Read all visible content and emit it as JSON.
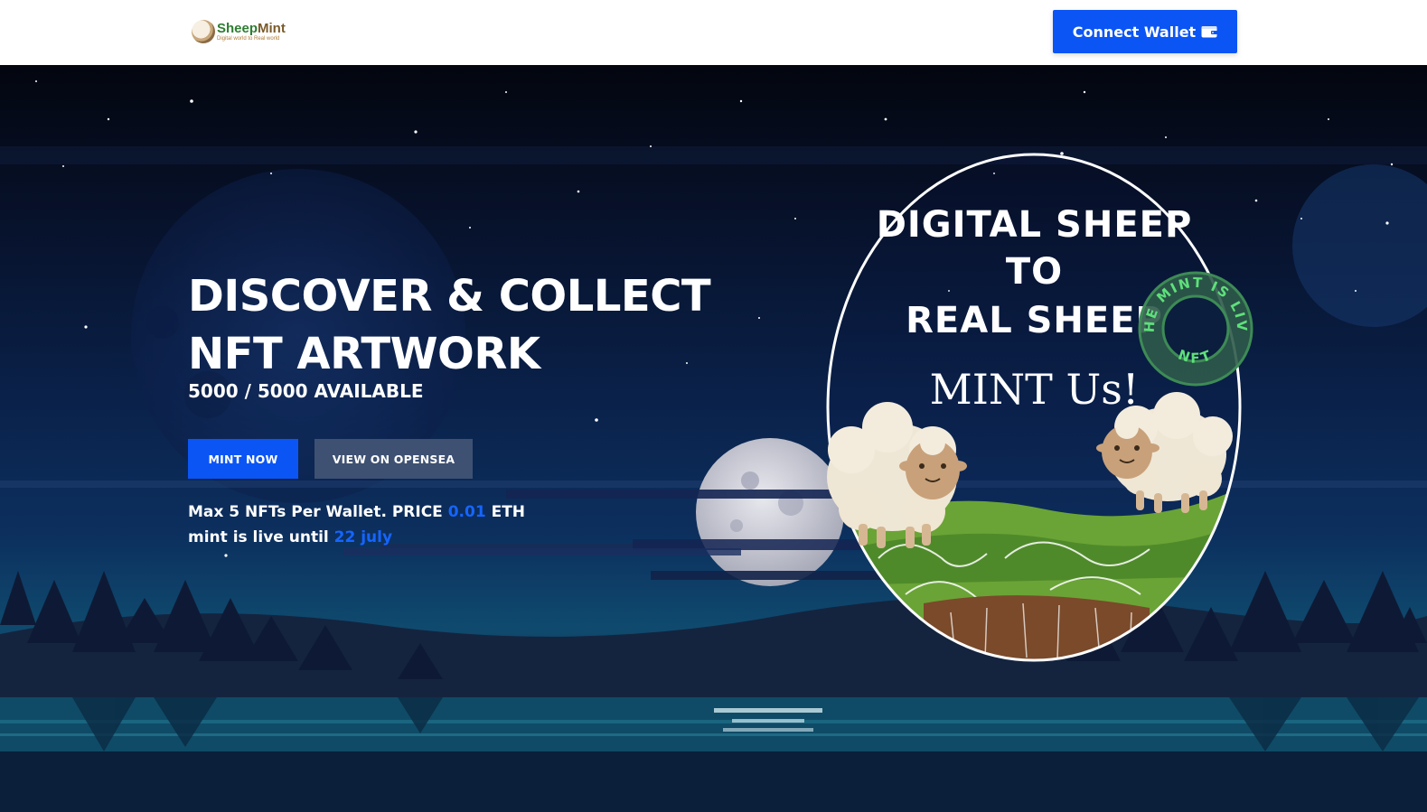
{
  "header": {
    "logo_name_part1": "Sheep",
    "logo_name_part2": "Mint",
    "logo_tagline": "Digital world to Real world",
    "connect_label": "Connect Wallet"
  },
  "hero": {
    "headline": "DISCOVER & COLLECT NFT ARTWORK",
    "available": "5000 / 5000 AVAILABLE",
    "mint_button": "MINT NOW",
    "opensea_button": "VIEW ON OPENSEA",
    "info_line1_prefix": "Max 5 NFTs Per Wallet. PRICE ",
    "price": "0.01",
    "info_line1_suffix": " ETH",
    "info_line2_prefix": "mint is live until ",
    "until_date": "22 july"
  },
  "artwork": {
    "title_line1": "DIGITAL SHEEP",
    "title_line2": "TO",
    "title_line3": "REAL SHEEP",
    "tagline": "MINT Us!",
    "badge_text_top": "THE MINT IS LIVE",
    "badge_text_bottom": "NFT"
  },
  "colors": {
    "accent_blue": "#0b55f5",
    "secondary_button": "#3e5173",
    "badge_green": "#43a047",
    "night_sky": "#07112a"
  },
  "icons": {
    "wallet": "wallet-icon"
  }
}
